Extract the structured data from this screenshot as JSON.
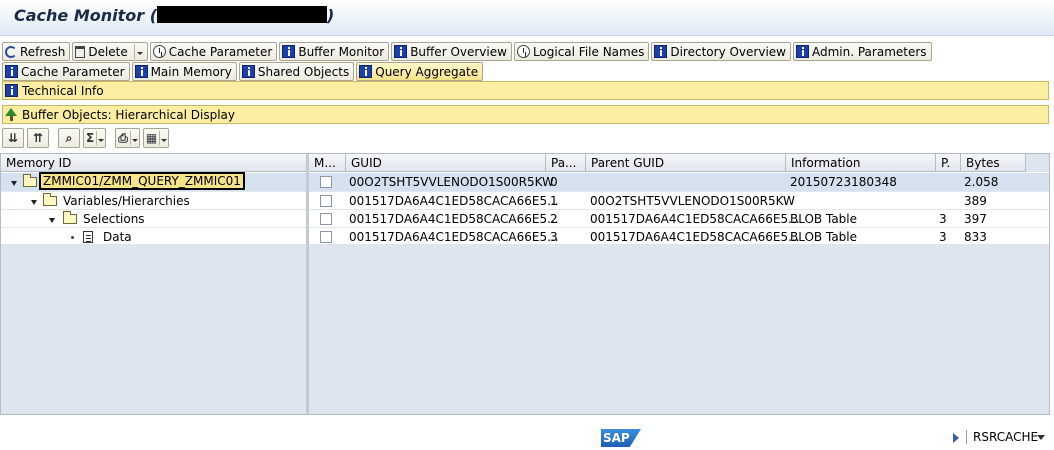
{
  "window": {
    "title": "Cache Monitor (",
    "title_close": ")"
  },
  "toolbar_row1": [
    {
      "label": "Refresh",
      "icon": "refresh-icon"
    },
    {
      "label": "Delete",
      "icon": "trash-icon",
      "dropdown": true
    },
    {
      "label": "Cache Parameter",
      "icon": "clock-icon"
    },
    {
      "label": "Buffer Monitor",
      "icon": "info-icon"
    },
    {
      "label": "Buffer Overview",
      "icon": "info-icon"
    },
    {
      "label": "Logical File Names",
      "icon": "clock-icon"
    },
    {
      "label": "Directory Overview",
      "icon": "info-icon"
    },
    {
      "label": "Admin. Parameters",
      "icon": "info-icon"
    }
  ],
  "toolbar_row2": [
    {
      "label": "Cache Parameter",
      "icon": "info-icon"
    },
    {
      "label": "Main Memory",
      "icon": "info-icon"
    },
    {
      "label": "Shared Objects",
      "icon": "info-icon"
    },
    {
      "label": "Query Aggregate",
      "icon": "info-icon",
      "active": true
    }
  ],
  "technical_info": {
    "label": "Technical Info"
  },
  "buffer_objects": {
    "label": "Buffer Objects: Hierarchical Display"
  },
  "columns": {
    "memory_id": "Memory ID",
    "m": "M...",
    "guid": "GUID",
    "pa": "Pa...",
    "parent_guid": "Parent GUID",
    "information": "Information",
    "p": "P.",
    "bytes": "Bytes"
  },
  "rows": [
    {
      "name": "ZMMIC01/ZMM_QUERY_ZMMIC01",
      "guid": "00O2TSHT5VVLENODO1S00R5KW",
      "pa": "0",
      "parent_guid": "",
      "information": "20150723180348",
      "p": "",
      "bytes": "2.058"
    },
    {
      "name": "Variables/Hierarchies",
      "guid": "001517DA6A4C1ED58CACA66E5...",
      "pa": "1",
      "parent_guid": "00O2TSHT5VVLENODO1S00R5KW",
      "information": "",
      "p": "",
      "bytes": "389"
    },
    {
      "name": "Selections",
      "guid": "001517DA6A4C1ED58CACA66E5...",
      "pa": "2",
      "parent_guid": "001517DA6A4C1ED58CACA66E5...",
      "information": "BLOB Table",
      "p": "3",
      "bytes": "397"
    },
    {
      "name": "Data",
      "guid": "001517DA6A4C1ED58CACA66E5...",
      "pa": "3",
      "parent_guid": "001517DA6A4C1ED58CACA66E5...",
      "information": "BLOB Table",
      "p": "3",
      "bytes": "833"
    }
  ],
  "status": {
    "logo": "SAP",
    "system": "RSRCACHE"
  },
  "colors": {
    "info_bar": "#fbeea3",
    "selected_row": "#d5e1ef",
    "highlight": "#f6e48a"
  }
}
